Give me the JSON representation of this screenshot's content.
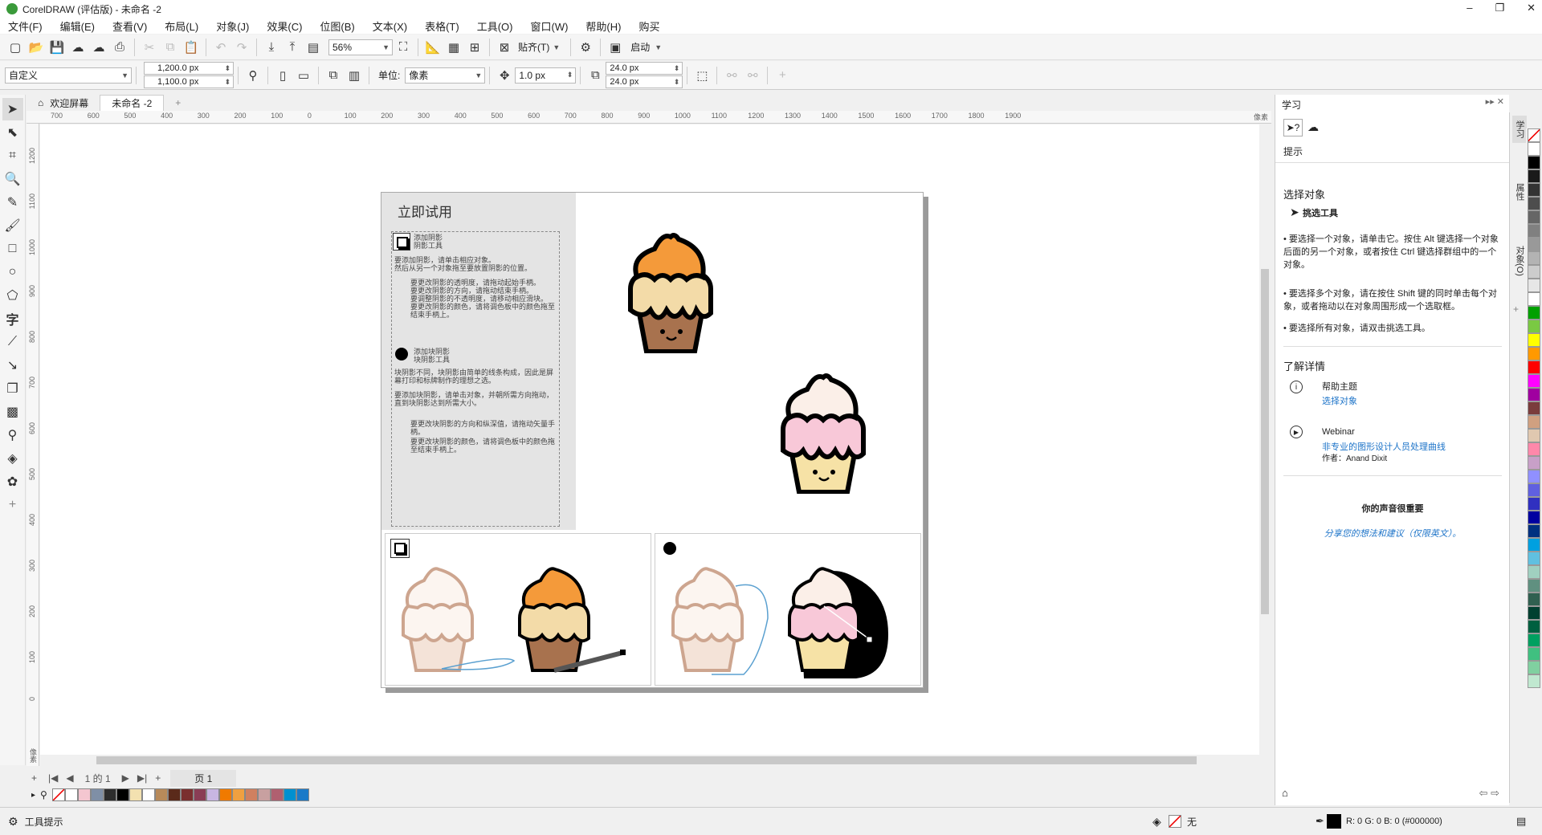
{
  "titlebar": {
    "title": "CorelDRAW (评估版) - 未命名 -2",
    "min": "–",
    "restore": "❐",
    "close": "✕"
  },
  "menu": [
    "文件(F)",
    "编辑(E)",
    "查看(V)",
    "布局(L)",
    "对象(J)",
    "效果(C)",
    "位图(B)",
    "文本(X)",
    "表格(T)",
    "工具(O)",
    "窗口(W)",
    "帮助(H)",
    "购买"
  ],
  "toolbar1": {
    "zoom": "56%",
    "snap_label": "贴齐(T)",
    "launch_label": "启动"
  },
  "toolbar2": {
    "preset": "自定义",
    "width": "1,200.0 px",
    "height": "1,100.0 px",
    "units_label": "单位:",
    "units_value": "像素",
    "nudge": "1.0 px",
    "dup_x": "24.0 px",
    "dup_y": "24.0 px"
  },
  "doctabs": {
    "welcome": "欢迎屏幕",
    "doc": "未命名 -2",
    "add": "+"
  },
  "ruler": {
    "h_ticks": [
      "700",
      "600",
      "500",
      "400",
      "300",
      "200",
      "100",
      "0",
      "100",
      "200",
      "300",
      "400",
      "500",
      "600",
      "700",
      "800",
      "900",
      "1000",
      "1100",
      "1200",
      "1300",
      "1400",
      "1500",
      "1600",
      "1700",
      "1800",
      "1900"
    ],
    "h_unit": "像素",
    "v_ticks": [
      "1200",
      "1100",
      "1000",
      "900",
      "800",
      "700",
      "600",
      "500",
      "400",
      "300",
      "200",
      "100",
      "0"
    ],
    "v_unit": "像素"
  },
  "hint_card": {
    "title": "立即试用",
    "section1_title": "添加阴影",
    "section1_sub": "阴影工具",
    "section1_p1": "要添加阴影，请单击相应对象。",
    "section1_p2": "然后从另一个对象拖至要放置阴影的位置。",
    "section1_bullets": [
      "要更改阴影的透明度，请拖动起始手柄。",
      "要更改阴影的方向，请拖动结束手柄。",
      "要调整阴影的不透明度，请移动相应滑块。",
      "要更改阴影的颜色，请将调色板中的颜色拖至结束手柄上。"
    ],
    "section2_title": "添加块阴影",
    "section2_sub": "块阴影工具",
    "section2_p1": "块阴影不同，块阴影由简单的线条构成，因此是屏幕打印和标牌制作的理想之选。",
    "section2_p2": "要添加块阴影，请单击对象，并朝所需方向拖动，直到块阴影达到所需大小。",
    "section2_bullets": [
      "要更改块阴影的方向和纵深值，请拖动矢量手柄。",
      "要更改块阴影的颜色，请将调色板中的颜色拖至结束手柄上。"
    ]
  },
  "pagebar": {
    "page_count": "1 的 1",
    "page_tab": "页 1"
  },
  "palette_strip": [
    "#ffffff",
    "#f4c6d0",
    "#7f8fa6",
    "#2d2d2d",
    "#000000",
    "#f3e1b0",
    "#ffffff",
    "#b88a5a",
    "#5a2a1a",
    "#7a2f2f",
    "#8a3d55",
    "#c8b6e2",
    "#f07a00",
    "#f0a040",
    "#d08060",
    "#c8a0a0",
    "#b06070",
    "#0090d0",
    "#1a7ac8"
  ],
  "status": {
    "hint": "工具提示",
    "fill_label": "无",
    "color_readout": "R: 0 G: 0 B: 0 (#000000)"
  },
  "learn_panel": {
    "title": "学习",
    "tab_label": "提示",
    "section_title": "选择对象",
    "tool_name": "挑选工具",
    "bullets": [
      "要选择一个对象，请单击它。按住 Alt 键选择一个对象后面的另一个对象，或者按住 Ctrl 键选择群组中的一个对象。",
      "要选择多个对象，请在按住 Shift 键的同时单击每个对象，或者拖动以在对象周围形成一个选取框。",
      "要选择所有对象，请双击挑选工具。"
    ],
    "learn_more": "了解详情",
    "help_title": "帮助主题",
    "help_link": "选择对象",
    "webinar_title": "Webinar",
    "webinar_link": "非专业的图形设计人员处理曲线",
    "webinar_author": "作者：Anand Dixit",
    "feedback_title": "你的声音很重要",
    "feedback_link": "分享您的想法和建议（仅限英文）。"
  },
  "docker_tabs": [
    "学习",
    "属性",
    "对象(O)"
  ],
  "color_palette": [
    "#ffffff",
    "#000000",
    "#1a1a1a",
    "#333333",
    "#4d4d4d",
    "#666666",
    "#808080",
    "#999999",
    "#b3b3b3",
    "#cccccc",
    "#e6e6e6",
    "#ffffff",
    "#00a000",
    "#7ac943",
    "#ffff00",
    "#ff9900",
    "#ff0000",
    "#ff00ff",
    "#a000a0",
    "#7a3c3c",
    "#d0a080",
    "#e0c8b0",
    "#ff88aa",
    "#c8a0c8",
    "#9090ff",
    "#6060e0",
    "#3030c0",
    "#0000a0",
    "#003080",
    "#00a0e0",
    "#60c0e0",
    "#a0d0c0",
    "#609080",
    "#306050",
    "#004030",
    "#006040",
    "#00a060",
    "#40c080",
    "#80d0a0",
    "#c0e8d0"
  ]
}
